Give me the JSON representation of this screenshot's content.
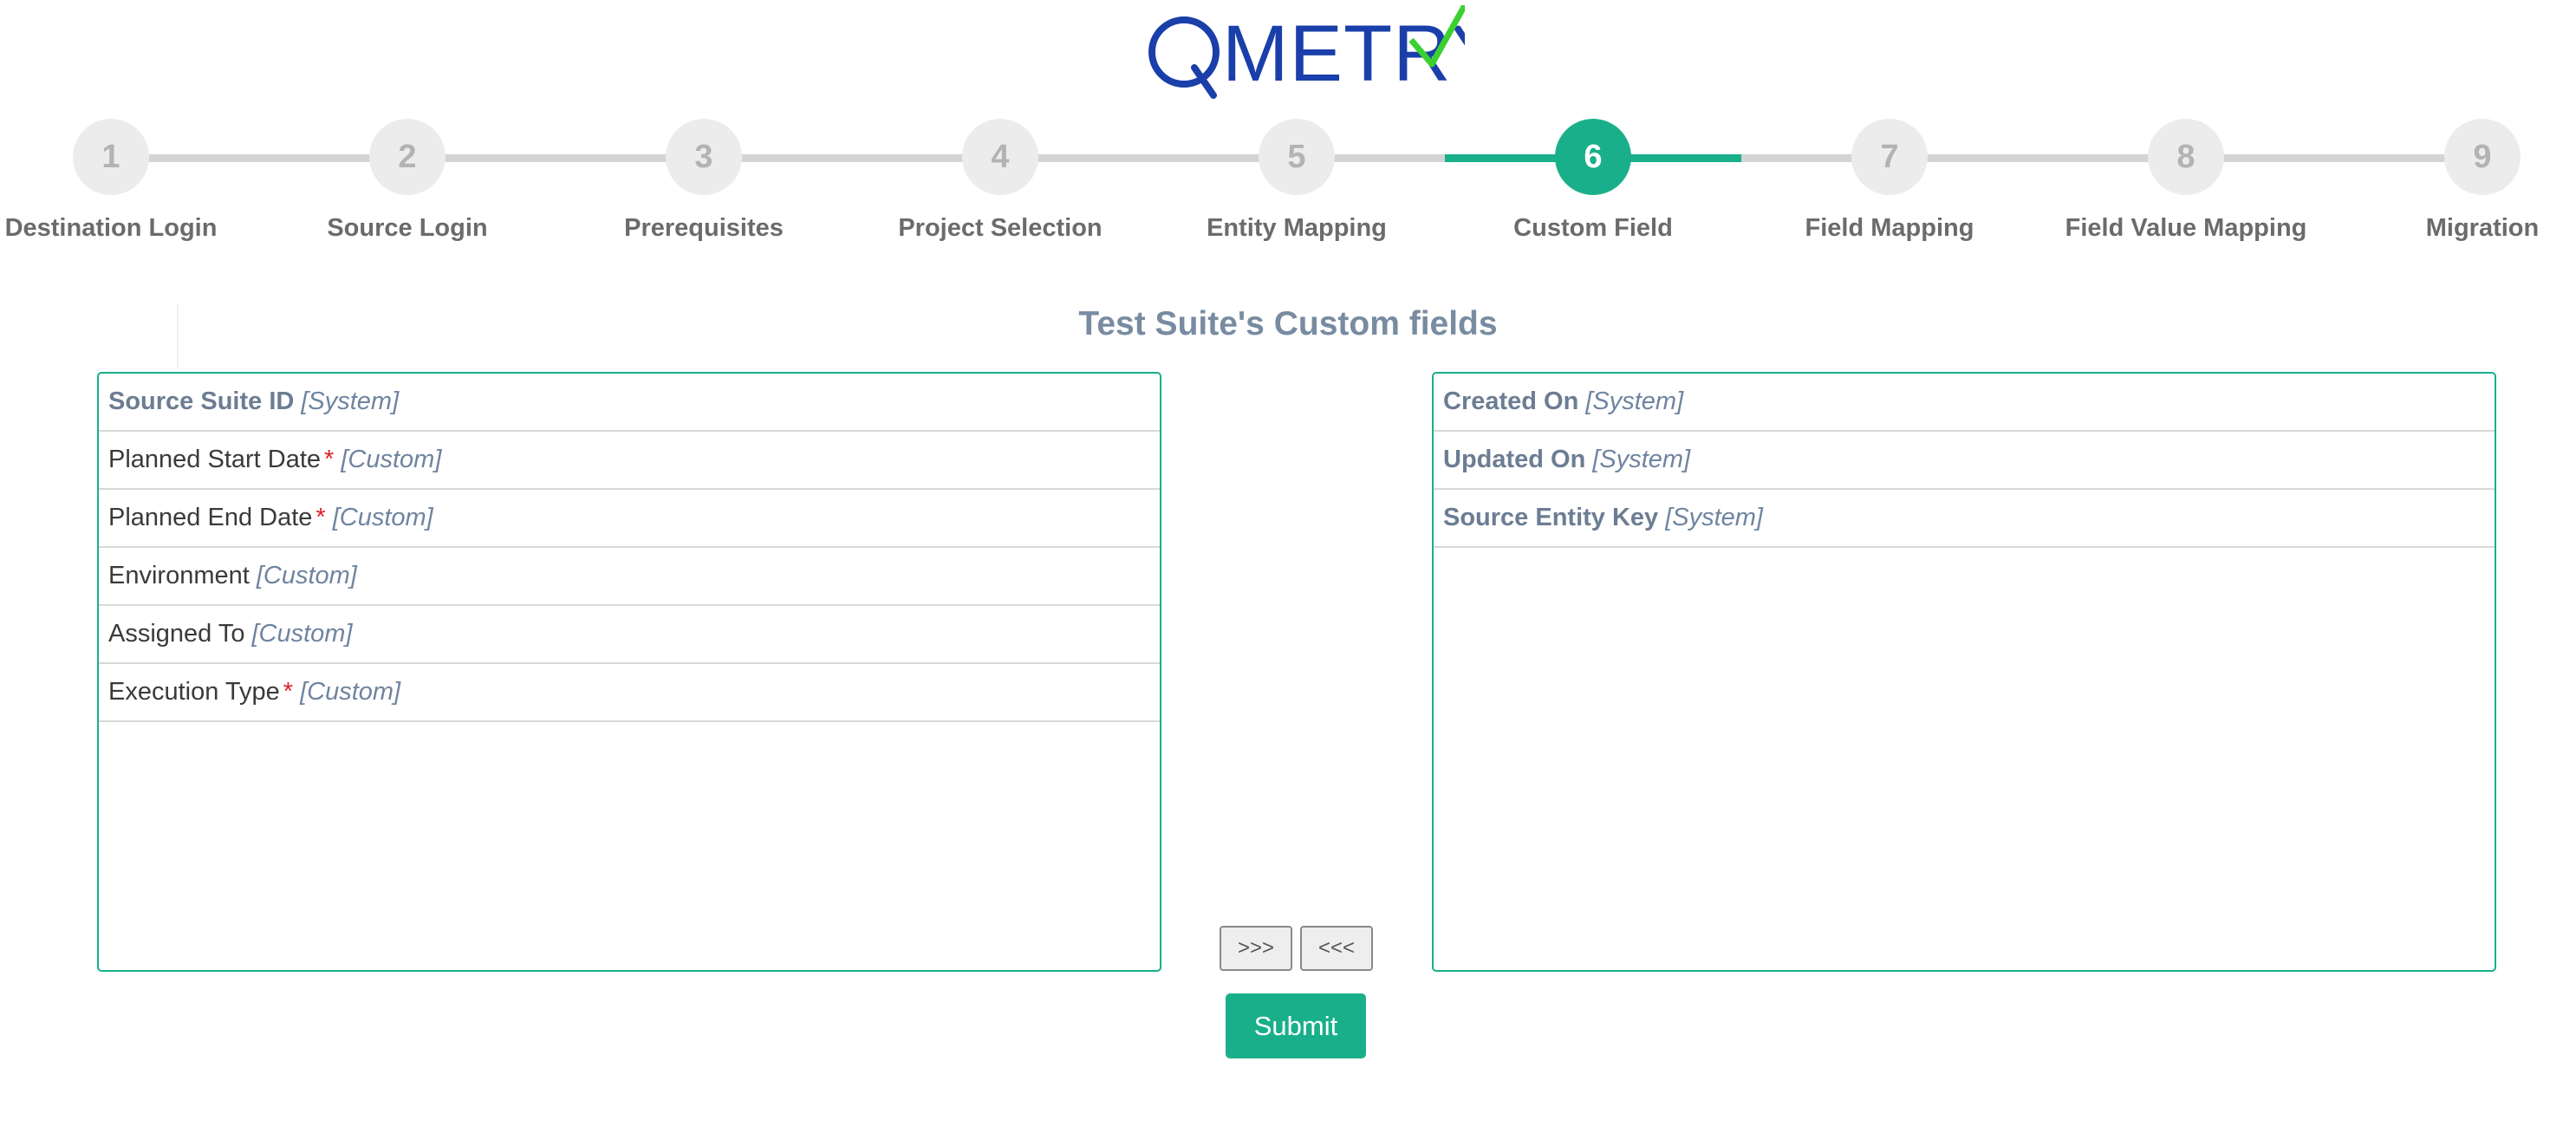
{
  "brand": {
    "logo_text": "QMETRY",
    "logo_color": "#1a3faa",
    "check_color": "#3ad12f",
    "accent": "#1aaf8b"
  },
  "stepper": {
    "active_step": 6,
    "steps": [
      {
        "number": "1",
        "label": "Destination Login"
      },
      {
        "number": "2",
        "label": "Source Login"
      },
      {
        "number": "3",
        "label": "Prerequisites"
      },
      {
        "number": "4",
        "label": "Project Selection"
      },
      {
        "number": "5",
        "label": "Entity Mapping"
      },
      {
        "number": "6",
        "label": "Custom Field"
      },
      {
        "number": "7",
        "label": "Field Mapping"
      },
      {
        "number": "8",
        "label": "Field Value Mapping"
      },
      {
        "number": "9",
        "label": "Migration"
      }
    ]
  },
  "section": {
    "title": "Test Suite's Custom fields"
  },
  "left_list": {
    "items": [
      {
        "name": "Source Suite ID",
        "required": false,
        "type": "[System]"
      },
      {
        "name": "Planned Start Date",
        "required": true,
        "type": "[Custom]"
      },
      {
        "name": "Planned End Date",
        "required": true,
        "type": "[Custom]"
      },
      {
        "name": "Environment",
        "required": false,
        "type": "[Custom]"
      },
      {
        "name": "Assigned To",
        "required": false,
        "type": "[Custom]"
      },
      {
        "name": "Execution Type",
        "required": true,
        "type": "[Custom]"
      }
    ]
  },
  "right_list": {
    "items": [
      {
        "name": "Created On",
        "required": false,
        "type": "[System]"
      },
      {
        "name": "Updated On",
        "required": false,
        "type": "[System]"
      },
      {
        "name": "Source Entity Key",
        "required": false,
        "type": "[System]"
      }
    ]
  },
  "controls": {
    "required_marker": "*",
    "move_right_label": ">>>",
    "move_left_label": "<<<",
    "submit_label": "Submit"
  }
}
